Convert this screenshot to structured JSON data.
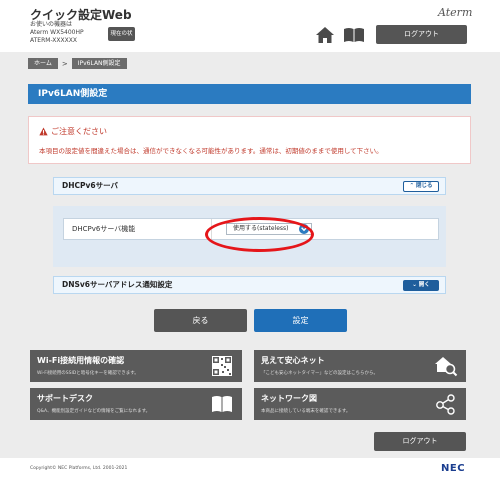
{
  "header": {
    "app_title": "クイック設定Web",
    "device_line1": "お使いの機器は",
    "device_line2": "Aterm  WX5400HP",
    "device_line3": "ATERM-XXXXXX",
    "status_button": "現在の状態",
    "brand": "Aterm",
    "logout": "ログアウト"
  },
  "breadcrumb": {
    "home": "ホーム",
    "separator": ">",
    "current": "IPv6LAN側設定"
  },
  "page_title": "IPv6LAN側設定",
  "notice": {
    "heading": "ご注意ください",
    "text": "本項目の設定値を間違えた場合は、通信ができなくなる可能性があります。通常は、初期値のままで使用して下さい。"
  },
  "dhcpv6": {
    "title": "DHCPv6サーバ",
    "toggle": "閉じる",
    "field_label": "DHCPv6サーバ機能",
    "selected_value": "使用する(stateless)"
  },
  "dnsv6": {
    "title": "DNSv6サーバアドレス通知設定",
    "toggle": "開く"
  },
  "actions": {
    "back": "戻る",
    "set": "設定"
  },
  "tiles": [
    {
      "title": "Wi-Fi接続用情報の確認",
      "desc": "Wi-Fi接続用のSSIDと暗号化キーを確認できます。"
    },
    {
      "title": "見えて安心ネット",
      "desc": "「こども安心ネットタイマー」などの設定はこちらから。"
    },
    {
      "title": "サポートデスク",
      "desc": "Q&A、機能別設定ガイドなどの情報をご覧になれます。"
    },
    {
      "title": "ネットワーク図",
      "desc": "本商品に接続している端末を確認できます。"
    }
  ],
  "footer": {
    "logout": "ログアウト",
    "copyright": "Copyright© NEC Platforms, Ltd. 2001-2021",
    "logo": "NEC"
  },
  "colors": {
    "accent_blue": "#2b7bc1",
    "warning_red": "#c0392b",
    "highlight_red": "#e5161a",
    "dark_button": "#555555"
  }
}
